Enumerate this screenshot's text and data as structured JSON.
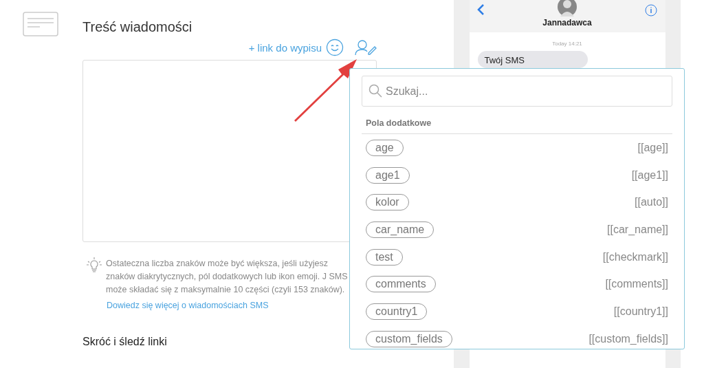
{
  "editor": {
    "title": "Treść wiadomości",
    "unsubscribe_link": "+ link do wypisu",
    "hint": "Ostateczna liczba znaków może być większa, jeśli użyjesz znaków diakrytycznych, pól dodatkowych lub ikon emoji. J SMS może składać się z maksymalnie 10 części (czyli 153 znaków).",
    "learn_more": "Dowiedz się więcej o wiadomościach SMS",
    "next_section": "Skróć i śledź linki"
  },
  "phone": {
    "contact": "Jannadawca",
    "time": "Today 14:21",
    "message": "Twój SMS"
  },
  "dropdown": {
    "search": {
      "placeholder": "Szukaj..."
    },
    "section": "Pola dodatkowe",
    "fields": [
      {
        "name": "age",
        "tag": "[[age]]"
      },
      {
        "name": "age1",
        "tag": "[[age1]]"
      },
      {
        "name": "kolor",
        "tag": "[[auto]]"
      },
      {
        "name": "car_name",
        "tag": "[[car_name]]"
      },
      {
        "name": "test",
        "tag": "[[checkmark]]"
      },
      {
        "name": "comments",
        "tag": "[[comments]]"
      },
      {
        "name": "country1",
        "tag": "[[country1]]"
      },
      {
        "name": "custom_fields",
        "tag": "[[custom_fields]]"
      }
    ]
  }
}
